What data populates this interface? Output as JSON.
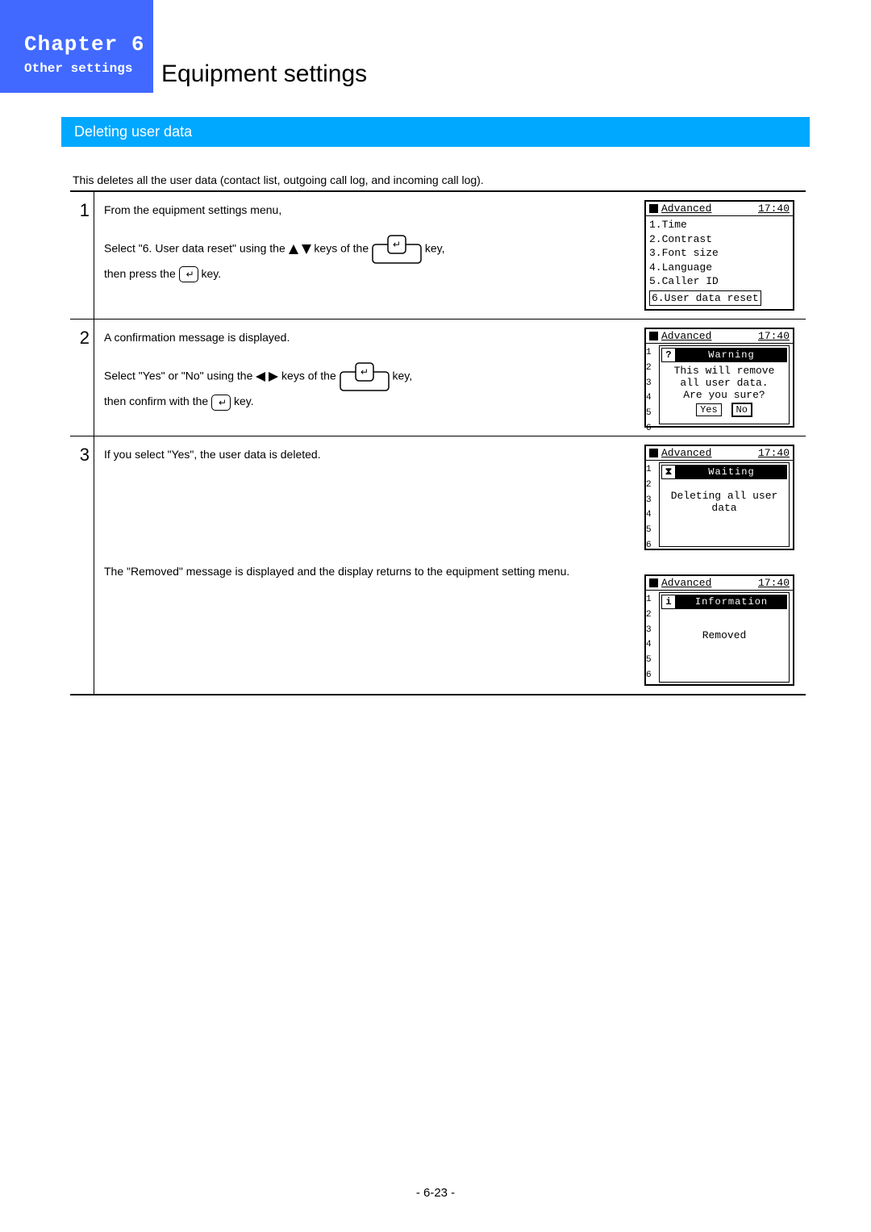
{
  "chapter": {
    "title": "Chapter 6",
    "subtitle": "Other settings"
  },
  "page_title": "Equipment settings",
  "section": "Deleting user data",
  "intro": "This deletes all the user data (contact list, outgoing call log, and incoming call log).",
  "steps": {
    "s1": {
      "num": "1",
      "line1": "From the equipment settings menu,",
      "line2a": "Select \"6. User data reset\" using the ",
      "line2b": " keys of the ",
      "line2c": " key,",
      "line3a": "then press the ",
      "line3b": " key."
    },
    "s2": {
      "num": "2",
      "line1": "A confirmation message is displayed.",
      "line2a": "Select \"Yes\" or \"No\" using the ",
      "line2b": " keys of the ",
      "line2c": " key,",
      "line3a": "then confirm with the ",
      "line3b": " key."
    },
    "s3": {
      "num": "3",
      "line1": "If you select \"Yes\", the user data is deleted.",
      "line2": "The \"Removed\" message is displayed and the display returns to the equipment setting menu."
    }
  },
  "lcd1": {
    "title": "Advanced",
    "time": "17:40",
    "items": [
      "1.Time",
      "2.Contrast",
      "3.Font size",
      "4.Language",
      "5.Caller ID"
    ],
    "highlight": "6.User data reset"
  },
  "lcd2": {
    "title": "Advanced",
    "time": "17:40",
    "dialog_title": "Warning",
    "msg1": "This will remove",
    "msg2": "all user data.",
    "msg3": "Are you sure?",
    "yes": "Yes",
    "no": "No",
    "digits": "1\n2\n3\n4\n5\n6"
  },
  "lcd3": {
    "title": "Advanced",
    "time": "17:40",
    "dialog_title": "Waiting",
    "msg1": "Deleting all user",
    "msg2": "data",
    "digits": "1\n2\n3\n4\n5\n6"
  },
  "lcd4": {
    "title": "Advanced",
    "time": "17:40",
    "dialog_title": "Information",
    "msg1": "Removed",
    "digits": "1\n2\n3\n4\n5\n6"
  },
  "page_number": "- 6-23 -"
}
